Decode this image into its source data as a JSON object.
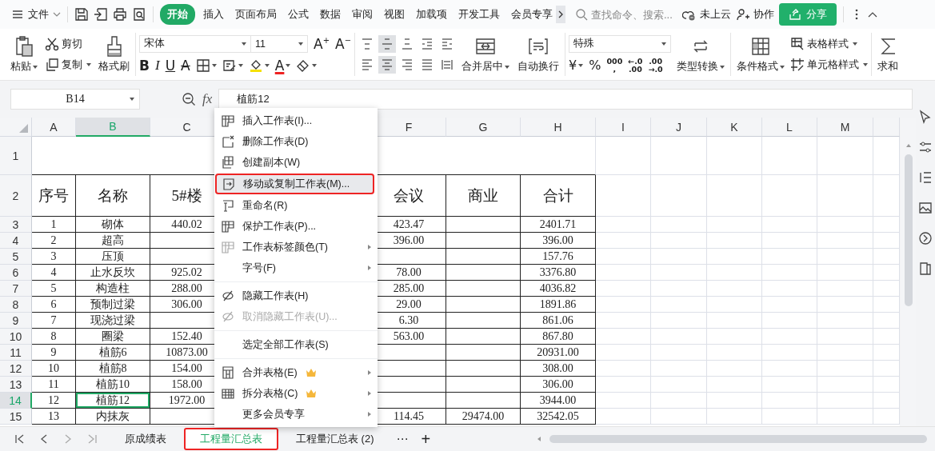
{
  "menubar": {
    "file": "文件",
    "tabs": [
      {
        "label": "开始",
        "selected": true
      },
      {
        "label": "插入",
        "selected": false
      },
      {
        "label": "页面布局",
        "selected": false
      },
      {
        "label": "公式",
        "selected": false
      },
      {
        "label": "数据",
        "selected": false
      },
      {
        "label": "审阅",
        "selected": false
      },
      {
        "label": "视图",
        "selected": false
      },
      {
        "label": "加载项",
        "selected": false
      },
      {
        "label": "开发工具",
        "selected": false
      },
      {
        "label": "会员专享",
        "selected": false
      }
    ],
    "search": {
      "placeholder": "查找命令、搜索..."
    },
    "cloud": "未上云",
    "collab": "协作",
    "share": "分享"
  },
  "ribbon": {
    "clipboard": {
      "paste": "粘贴",
      "cut": "剪切",
      "copy": "复制",
      "painter": "格式刷"
    },
    "font": {
      "name": "宋体",
      "size": "11",
      "grow": "A",
      "grow_sign": "+",
      "shrink": "A",
      "shrink_sign": "−",
      "bold": "B",
      "italic": "I",
      "underline": "U",
      "strike": "A",
      "color_glyph": "A"
    },
    "align": [
      {
        "kind": "top",
        "selected": false
      },
      {
        "kind": "middle",
        "selected": true
      },
      {
        "kind": "bottom",
        "selected": false
      },
      {
        "kind": "outdent",
        "selected": false
      },
      {
        "kind": "indent",
        "selected": false
      },
      {
        "kind": "left",
        "selected": false
      },
      {
        "kind": "center",
        "selected": true
      },
      {
        "kind": "right",
        "selected": false
      },
      {
        "kind": "justify",
        "selected": false
      },
      {
        "kind": "distributed",
        "selected": false
      }
    ],
    "merge": "合并居中",
    "wrap": "自动换行",
    "number": {
      "format": "特殊",
      "currency": "¥",
      "percent": "%",
      "thousands": [
        "000",
        ","
      ],
      "increase": [
        "←.0",
        ".00"
      ],
      "decrease": [
        ".00",
        "→.0"
      ],
      "convert": "类型转换"
    },
    "styles": {
      "conditional": "条件格式",
      "table_style": "表格样式",
      "cell_style": "单元格样式"
    },
    "sum": "求和"
  },
  "formula_bar": {
    "cell_ref": "B14",
    "fx": "fx",
    "value": "植筋12"
  },
  "sheet": {
    "columns": [
      {
        "label": "A",
        "selected": false
      },
      {
        "label": "B",
        "selected": true
      },
      {
        "label": "C",
        "selected": false
      },
      {
        "label": "F",
        "selected": false
      },
      {
        "label": "G",
        "selected": false
      },
      {
        "label": "H",
        "selected": false
      },
      {
        "label": "I",
        "selected": false
      },
      {
        "label": "J",
        "selected": false
      },
      {
        "label": "K",
        "selected": false
      },
      {
        "label": "L",
        "selected": false
      },
      {
        "label": "M",
        "selected": false
      }
    ],
    "rows": [
      {
        "row": "1",
        "selected": false,
        "cells": []
      },
      {
        "row": "2",
        "selected": false,
        "cells": [
          "序号",
          "名称",
          "5#楼",
          "会议",
          "商业",
          "合计"
        ]
      },
      {
        "row": "3",
        "selected": false,
        "cells": [
          "1",
          "砌体",
          "440.02",
          "423.47",
          "",
          "2401.71"
        ]
      },
      {
        "row": "4",
        "selected": false,
        "cells": [
          "2",
          "超高",
          "",
          "396.00",
          "",
          "396.00"
        ]
      },
      {
        "row": "5",
        "selected": false,
        "cells": [
          "3",
          "压顶",
          "",
          "",
          "",
          "157.76"
        ]
      },
      {
        "row": "6",
        "selected": false,
        "cells": [
          "4",
          "止水反坎",
          "925.02",
          "78.00",
          "",
          "3376.80"
        ]
      },
      {
        "row": "7",
        "selected": false,
        "cells": [
          "5",
          "构造柱",
          "288.00",
          "285.00",
          "",
          "4036.82"
        ]
      },
      {
        "row": "8",
        "selected": false,
        "cells": [
          "6",
          "预制过梁",
          "306.00",
          "29.00",
          "",
          "1891.86"
        ]
      },
      {
        "row": "9",
        "selected": false,
        "cells": [
          "7",
          "现浇过梁",
          "",
          "6.30",
          "",
          "861.06"
        ]
      },
      {
        "row": "10",
        "selected": false,
        "cells": [
          "8",
          "圈梁",
          "152.40",
          "563.00",
          "",
          "867.80"
        ]
      },
      {
        "row": "11",
        "selected": false,
        "cells": [
          "9",
          "植筋6",
          "10873.00",
          "",
          "",
          "20931.00"
        ]
      },
      {
        "row": "12",
        "selected": false,
        "cells": [
          "10",
          "植筋8",
          "154.00",
          "",
          "",
          "308.00"
        ]
      },
      {
        "row": "13",
        "selected": false,
        "cells": [
          "11",
          "植筋10",
          "158.00",
          "",
          "",
          "306.00"
        ]
      },
      {
        "row": "14",
        "selected": true,
        "cells": [
          "12",
          "植筋12",
          "1972.00",
          "",
          "",
          "3944.00"
        ]
      },
      {
        "row": "15",
        "selected": false,
        "cells": [
          "13",
          "内抹灰",
          "",
          "114.45",
          "29474.00",
          "32542.05"
        ]
      }
    ]
  },
  "context_menu": [
    {
      "kind": "insert",
      "label": "插入工作表(I)...",
      "selected": false,
      "disabled": false,
      "submenu": false,
      "crown": false
    },
    {
      "kind": "delete",
      "label": "删除工作表(D)",
      "selected": false,
      "disabled": false,
      "submenu": false,
      "crown": false
    },
    {
      "kind": "duplicate",
      "label": "创建副本(W)",
      "selected": false,
      "disabled": false,
      "submenu": false,
      "crown": false
    },
    {
      "kind": "move",
      "label": "移动或复制工作表(M)...",
      "selected": true,
      "disabled": false,
      "submenu": false,
      "crown": false
    },
    {
      "kind": "rename",
      "label": "重命名(R)",
      "selected": false,
      "disabled": false,
      "submenu": false,
      "crown": false
    },
    {
      "kind": "protect",
      "label": "保护工作表(P)...",
      "selected": false,
      "disabled": false,
      "submenu": false,
      "crown": false
    },
    {
      "kind": "tabcolor",
      "label": "工作表标签颜色(T)",
      "selected": false,
      "disabled": false,
      "submenu": true,
      "crown": false
    },
    {
      "kind": "plain",
      "label": "字号(F)",
      "selected": false,
      "disabled": false,
      "submenu": true,
      "crown": false
    },
    {
      "kind": "separator"
    },
    {
      "kind": "hide",
      "label": "隐藏工作表(H)",
      "selected": false,
      "disabled": false,
      "submenu": false,
      "crown": false
    },
    {
      "kind": "hide",
      "label": "取消隐藏工作表(U)...",
      "selected": false,
      "disabled": true,
      "submenu": false,
      "crown": false
    },
    {
      "kind": "separator"
    },
    {
      "kind": "plain",
      "label": "选定全部工作表(S)",
      "selected": false,
      "disabled": false,
      "submenu": false,
      "crown": false
    },
    {
      "kind": "separator"
    },
    {
      "kind": "merge",
      "label": "合并表格(E)",
      "selected": false,
      "disabled": false,
      "submenu": true,
      "crown": true
    },
    {
      "kind": "split",
      "label": "拆分表格(C)",
      "selected": false,
      "disabled": false,
      "submenu": true,
      "crown": true
    },
    {
      "kind": "plain",
      "label": "更多会员专享",
      "selected": false,
      "disabled": false,
      "submenu": true,
      "crown": false
    }
  ],
  "sheet_tabs": {
    "tabs": [
      {
        "label": "原成绩表",
        "selected": false
      },
      {
        "label": "工程量汇总表",
        "selected": true
      },
      {
        "label": "工程量汇总表 (2)",
        "selected": false
      }
    ],
    "more": "⋯",
    "add": "+"
  }
}
